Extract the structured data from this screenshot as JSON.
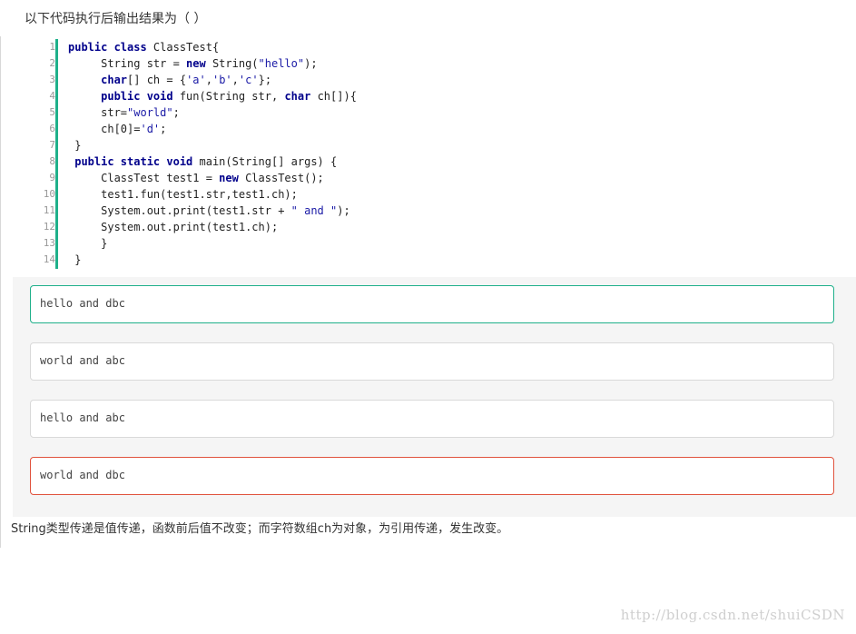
{
  "question": "以下代码执行后输出结果为（ ）",
  "code": {
    "line_numbers": [
      "1",
      "2",
      "3",
      "4",
      "5",
      "6",
      "7",
      "8",
      "9",
      "10",
      "11",
      "12",
      "13",
      "14"
    ]
  },
  "options": [
    {
      "text": "hello and dbc",
      "state": "selected-correct"
    },
    {
      "text": "world and abc",
      "state": "normal"
    },
    {
      "text": "hello and abc",
      "state": "normal"
    },
    {
      "text": "world and dbc",
      "state": "selected-wrong"
    }
  ],
  "explanation": "String类型传递是值传递，函数前后值不改变；而字符数组ch为对象，为引用传递，发生改变。",
  "watermark": "http://blog.csdn.net/shuiCSDN",
  "colors": {
    "accent_green": "#1fb08a",
    "wrong_red": "#e0533d",
    "keyword": "#00008b",
    "string": "#1a1aa6"
  }
}
